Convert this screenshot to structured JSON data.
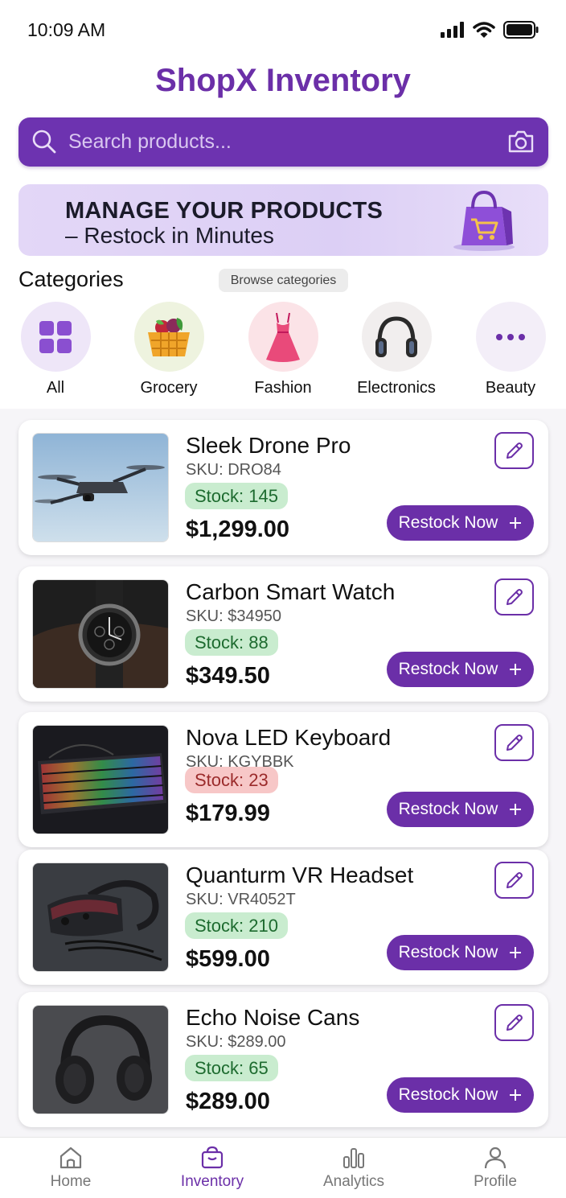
{
  "status_bar": {
    "time": "10:09 AM"
  },
  "app": {
    "title": "ShopX Inventory"
  },
  "search": {
    "placeholder": "Search products..."
  },
  "banner": {
    "line1": "MANAGE YOUR PRODUCTS",
    "line2": "– Restock in Minutes"
  },
  "categories": {
    "title": "Categories",
    "browse_label": "Browse categories",
    "items": [
      {
        "label": "All",
        "icon": "grid-icon"
      },
      {
        "label": "Grocery",
        "icon": "basket-icon"
      },
      {
        "label": "Fashion",
        "icon": "dress-icon"
      },
      {
        "label": "Electronics",
        "icon": "headphones-icon"
      },
      {
        "label": "Beauty",
        "icon": "more-icon"
      }
    ]
  },
  "products": [
    {
      "name": "Sleek Drone Pro",
      "sku": "SKU: DRO84",
      "stock": "Stock: 145",
      "stock_status": "ok",
      "price": "$1,299.00",
      "restock_label": "Restock Now",
      "image": "drone"
    },
    {
      "name": "Carbon Smart Watch",
      "sku": "SKU: $34950",
      "stock": "Stock: 88",
      "stock_status": "ok",
      "price": "$349.50",
      "restock_label": "Restock Now",
      "image": "watch"
    },
    {
      "name": "Nova LED Keyboard",
      "sku": "SKU: KGYBBK",
      "stock": "Stock: 23",
      "stock_status": "low",
      "price": "$179.99",
      "restock_label": "Restock Now",
      "image": "keyboard"
    },
    {
      "name": "Quanturm VR Headset",
      "sku": "SKU: VR4052T",
      "stock": "Stock: 210",
      "stock_status": "ok",
      "price": "$599.00",
      "restock_label": "Restock Now",
      "image": "vr-headset"
    },
    {
      "name": "Echo Noise Cans",
      "sku": "SKU: $289.00",
      "stock": "Stock: 65",
      "stock_status": "ok",
      "price": "$289.00",
      "restock_label": "Restock Now",
      "image": "headphones"
    }
  ],
  "bottom_nav": {
    "items": [
      {
        "label": "Home",
        "icon": "home-icon",
        "active": false
      },
      {
        "label": "Inventory",
        "icon": "inventory-icon",
        "active": true
      },
      {
        "label": "Analytics",
        "icon": "analytics-icon",
        "active": false
      },
      {
        "label": "Profile",
        "icon": "profile-icon",
        "active": false
      }
    ]
  },
  "colors": {
    "brand": "#6b2fa8",
    "stock_ok_bg": "#c9eccf",
    "stock_low_bg": "#f7c7c7",
    "banner_bg": "#e3d7f7"
  }
}
